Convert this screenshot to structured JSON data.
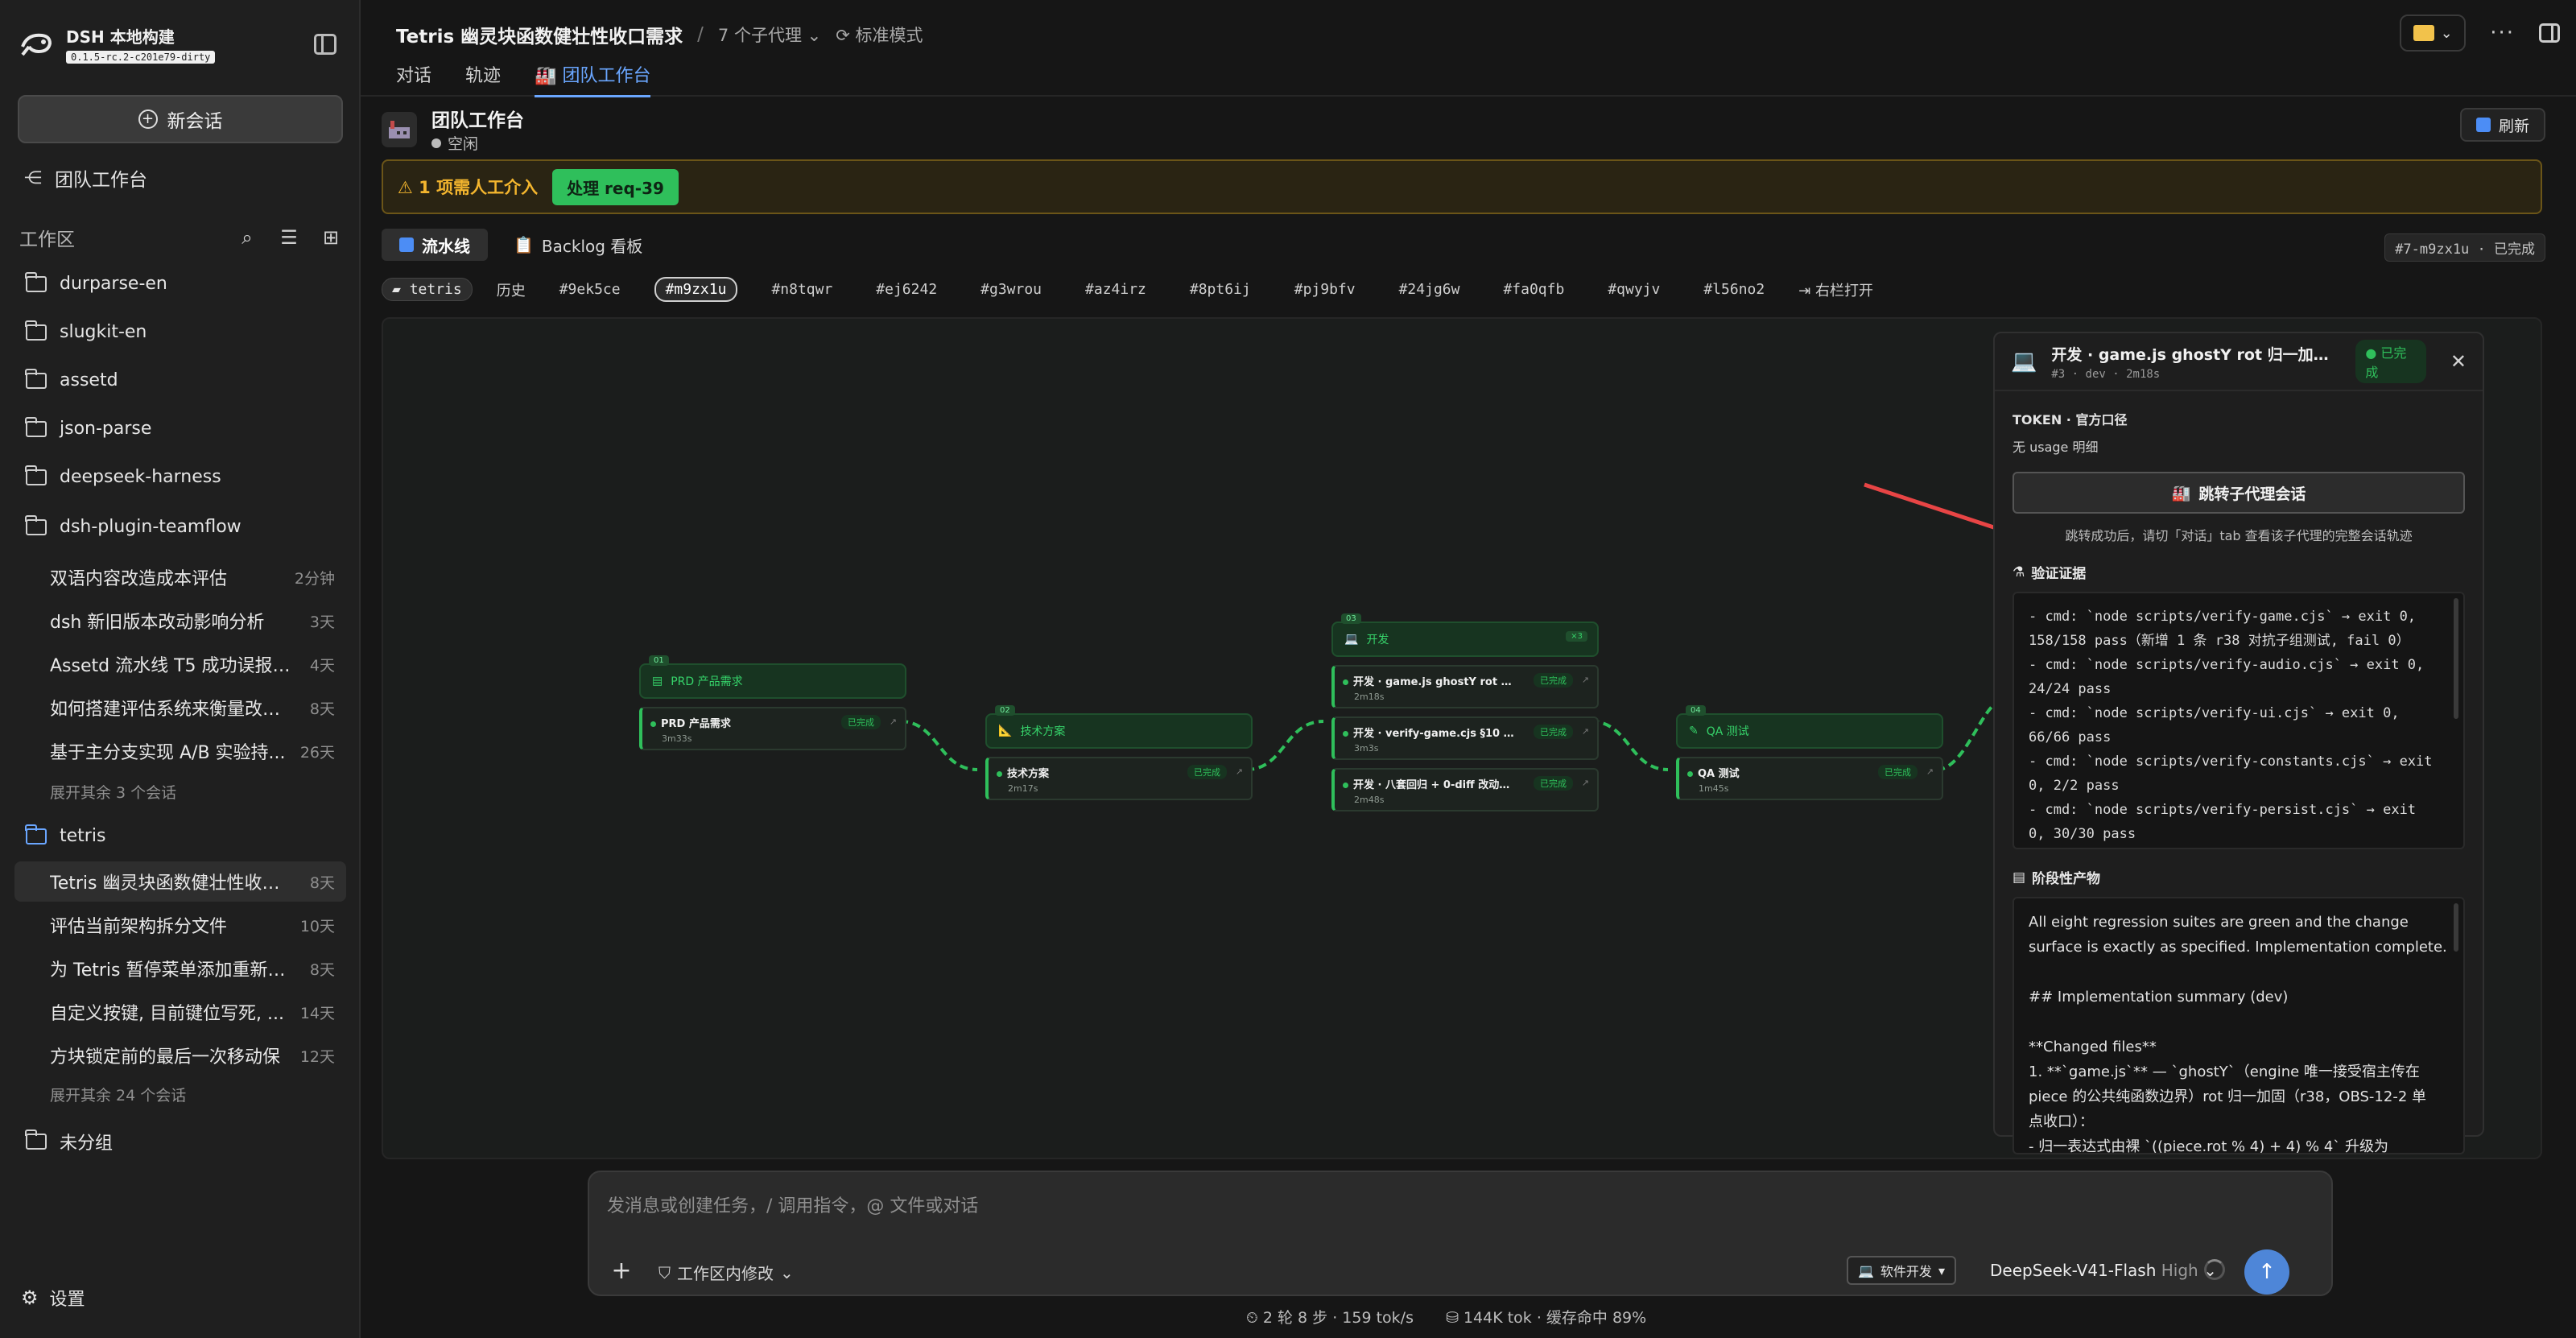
{
  "app": {
    "name": "DSH 本地构建",
    "version": "0.1.5-rc.2-c201e79-dirty"
  },
  "sidebar": {
    "new_chat": "新会话",
    "team_workspace": "团队工作台",
    "workspace_label": "工作区",
    "folders": [
      "durparse-en",
      "slugkit-en",
      "assetd",
      "json-parse",
      "deepseek-harness",
      "dsh-plugin-teamflow"
    ],
    "teamflow_sessions": [
      {
        "title": "双语内容改造成本评估",
        "age": "2分钟"
      },
      {
        "title": "dsh 新旧版本改动影响分析",
        "age": "3天"
      },
      {
        "title": "Assetd 流水线 T5 成功误报失败",
        "age": "4天"
      },
      {
        "title": "如何搭建评估系统来衡量改动...",
        "age": "8天"
      },
      {
        "title": "基于主分支实现 A/B 实验持...",
        "age": "26天"
      }
    ],
    "teamflow_more": "展开其余 3 个会话",
    "tetris_folder": "tetris",
    "tetris_sessions": [
      {
        "title": "Tetris 幽灵块函数健壮性收口...",
        "age": "8天"
      },
      {
        "title": "评估当前架构拆分文件",
        "age": "10天"
      },
      {
        "title": "为 Tetris 暂停菜单添加重新开...",
        "age": "8天"
      },
      {
        "title": "自定义按键, 目前键位写死, ...",
        "age": "14天"
      },
      {
        "title": "方块锁定前的最后一次移动保",
        "age": "12天"
      }
    ],
    "tetris_more": "展开其余 24 个会话",
    "ungrouped": "未分组",
    "settings": "设置"
  },
  "header": {
    "title": "Tetris 幽灵块函数健壮性收口需求",
    "sep": "/",
    "subagents": "7 个子代理",
    "mode": "标准模式",
    "tabs": [
      "对话",
      "轨迹",
      "团队工作台"
    ]
  },
  "workspace": {
    "name": "团队工作台",
    "state": "空闲",
    "refresh": "刷新"
  },
  "alert": {
    "text": "1 项需人工介入",
    "action": "处理 req-39"
  },
  "view_tabs": [
    "流水线",
    "Backlog 看板"
  ],
  "stage_id": "#7-m9zx1u · 已完成",
  "chips": {
    "project": "tetris",
    "history": "历史",
    "runs": [
      "#9ek5ce",
      "#m9zx1u",
      "#n8tqwr",
      "#ej6242",
      "#g3wrou",
      "#az4irz",
      "#8pt6ij",
      "#pj9bfv",
      "#24jg6w",
      "#fa0qfb",
      "#qwyjv",
      "#l56no2"
    ],
    "open_right": "右栏打开"
  },
  "pipeline": [
    {
      "num": "01",
      "name": "PRD 产品需求",
      "tasks": [
        {
          "name": "PRD 产品需求",
          "time": "3m33s",
          "status": "已完成"
        }
      ]
    },
    {
      "num": "02",
      "name": "技术方案",
      "tasks": [
        {
          "name": "技术方案",
          "time": "2m17s",
          "status": "已完成"
        }
      ]
    },
    {
      "num": "03",
      "name": "开发",
      "badge": "×3",
      "tasks": [
        {
          "name": "开发 · game.js ghostY rot 归一...",
          "time": "2m18s",
          "status": "已完成"
        },
        {
          "name": "开发 · verify-game.cjs §10 追加 r...",
          "time": "3m3s",
          "status": "已完成"
        },
        {
          "name": "开发 · 八套回归 + 0-diff 改动面...",
          "time": "2m48s",
          "status": "已完成"
        }
      ]
    },
    {
      "num": "04",
      "name": "QA 测试",
      "tasks": [
        {
          "name": "QA 测试",
          "time": "1m45s",
          "status": "已完成"
        }
      ]
    }
  ],
  "detail": {
    "title": "开发 · game.js ghostY rot 归一加固...",
    "sub": "#3 · dev · 2m18s",
    "status": "已完成",
    "token_label": "TOKEN · 官方口径",
    "token_value": "无 usage 明细",
    "jump": "跳转子代理会话",
    "hint": "跳转成功后，请切「对话」tab 查看该子代理的完整会话轨迹",
    "evidence_label": "验证证据",
    "evidence": [
      "- cmd: `node scripts/verify-game.cjs` → exit 0,",
      "158/158 pass（新增 1 条 r38 对抗子组测试, fail 0）",
      "- cmd: `node scripts/verify-audio.cjs` → exit 0,",
      "24/24 pass",
      "- cmd: `node scripts/verify-ui.cjs` → exit 0,",
      "66/66 pass",
      "- cmd: `node scripts/verify-constants.cjs` → exit",
      "0, 2/2 pass",
      "- cmd: `node scripts/verify-persist.cjs` → exit",
      "0, 30/30 pass"
    ],
    "artifact_label": "阶段性产物",
    "artifact": [
      "All eight regression suites are green and the change",
      "surface is exactly as specified. Implementation complete.",
      "",
      "## Implementation summary (dev)",
      "",
      "**Changed files**",
      "1. **`game.js`** — `ghostY`（engine 唯一接受宿主传在",
      "piece 的公共纯函数边界）rot 归一加固（r38，OBS-12-2 单",
      "点收口）：",
      "  - 归一表达式由裸 `((piece.rot % 4) + 4) % 4` 升级为"
    ]
  },
  "composer": {
    "placeholder": "发消息或创建任务，/ 调用指令，@ 文件或对话",
    "scope": "工作区内修改",
    "mode": "软件开发",
    "model": "DeepSeek-V41-Flash",
    "level": "High"
  },
  "statusbar": {
    "steps": "2 轮 8 步 · 159 tok/s",
    "tokens": "144K tok · 缓存命中 89%"
  }
}
